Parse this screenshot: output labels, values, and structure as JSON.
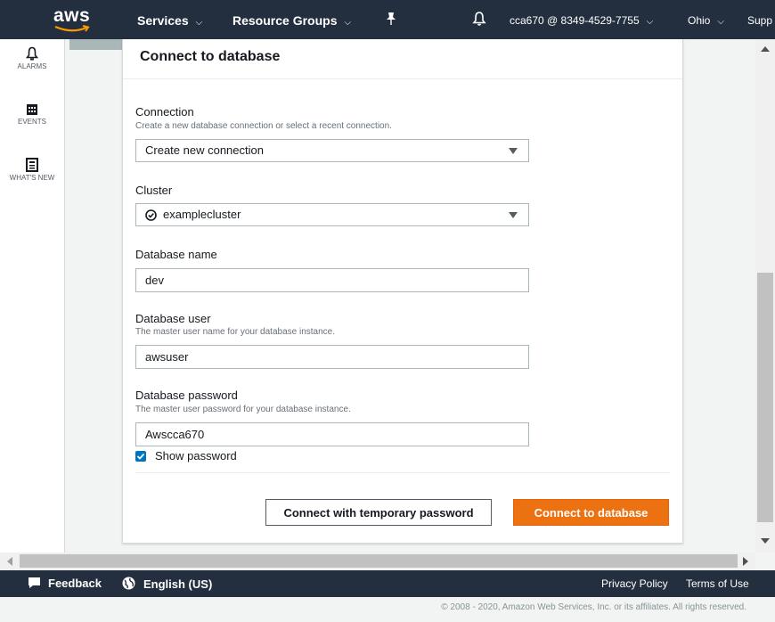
{
  "topbar": {
    "logo_text": "aws",
    "services": "Services",
    "resource_groups": "Resource Groups",
    "account": "cca670 @ 8349-4529-7755",
    "region": "Ohio",
    "support": "Supp"
  },
  "rail": {
    "items": [
      {
        "label": "ALARMS",
        "icon": "bell-icon"
      },
      {
        "label": "EVENTS",
        "icon": "calendar-icon"
      },
      {
        "label": "WHAT'S NEW",
        "icon": "newspaper-icon"
      }
    ]
  },
  "modal": {
    "title": "Connect to database",
    "connection": {
      "label": "Connection",
      "description": "Create a new database connection or select a recent connection.",
      "value": "Create new connection"
    },
    "cluster": {
      "label": "Cluster",
      "value": "examplecluster"
    },
    "database_name": {
      "label": "Database name",
      "value": "dev"
    },
    "database_user": {
      "label": "Database user",
      "description": "The master user name for your database instance.",
      "value": "awsuser"
    },
    "database_password": {
      "label": "Database password",
      "description": "The master user password for your database instance.",
      "value": "Awscca670"
    },
    "show_password": {
      "label": "Show password",
      "checked": true
    },
    "temp_button": "Connect with temporary password",
    "connect_button": "Connect to database"
  },
  "footer": {
    "feedback": "Feedback",
    "language": "English (US)",
    "privacy": "Privacy Policy",
    "terms": "Terms of Use",
    "copyright": "© 2008 - 2020, Amazon Web Services, Inc. or its affiliates. All rights reserved."
  },
  "colors": {
    "nav_bg": "#232f3e",
    "primary": "#ec7211",
    "checkbox": "#0073bb"
  }
}
